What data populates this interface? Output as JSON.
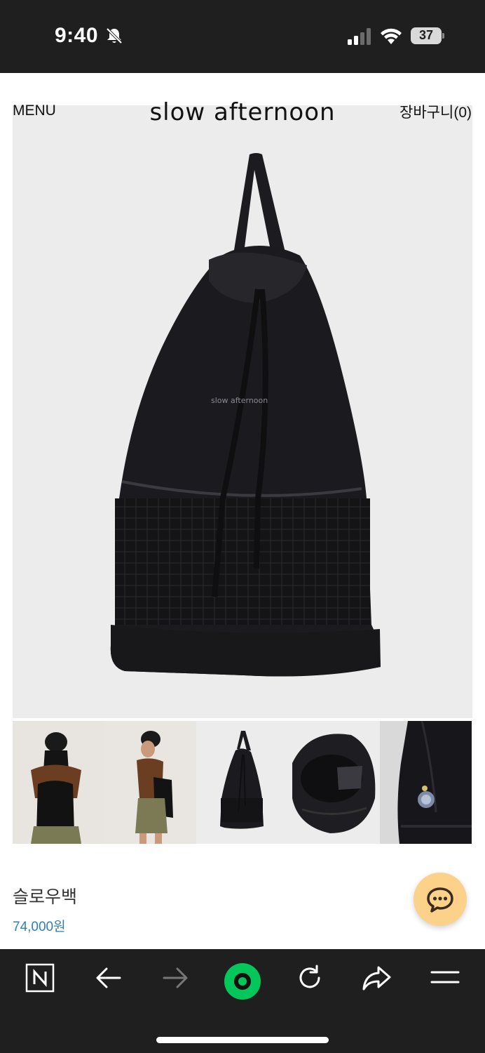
{
  "status_bar": {
    "time": "9:40",
    "battery": "37",
    "icons": [
      "bell-off-icon",
      "signal-icon",
      "wifi-icon",
      "battery-icon"
    ]
  },
  "header": {
    "menu_label": "MENU",
    "logo_text": "slow afternoon",
    "cart_label": "장바구니(0)"
  },
  "main_image": {
    "logo_on_bag": "slow afternoon"
  },
  "thumbnails": {
    "count": 5,
    "selected_index": 3
  },
  "product": {
    "name": "슬로우백",
    "price": "74,000원"
  },
  "chat_button": {
    "icon": "chat-bubble-icon"
  },
  "browser_toolbar": {
    "icons": [
      "naver-n-icon",
      "back-arrow-icon",
      "forward-arrow-icon",
      "home-circle-icon",
      "reload-icon",
      "share-icon",
      "hamburger-menu-icon"
    ]
  },
  "colors": {
    "status_bar_bg": "#1f1f1f",
    "price_color": "#2f7fb3",
    "chat_fab_bg": "#fcd18a",
    "home_button_green": "#03c75a"
  }
}
